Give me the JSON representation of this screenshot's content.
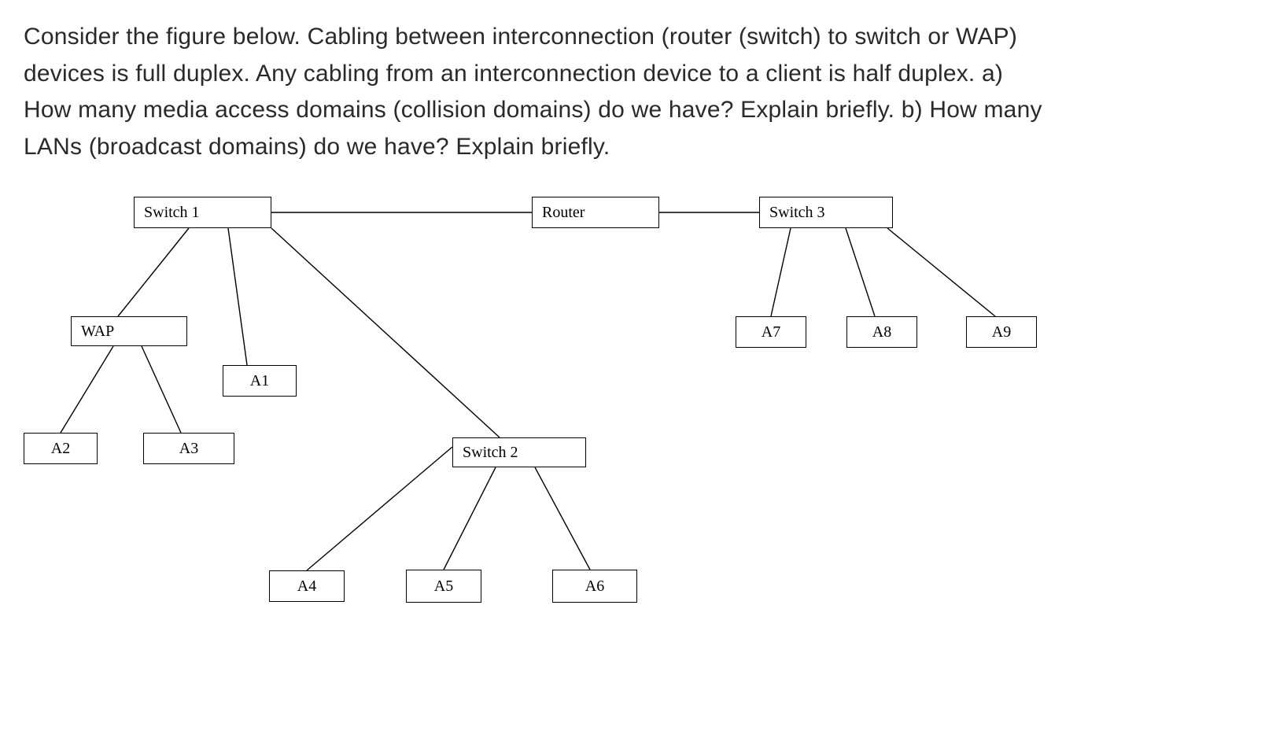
{
  "question": "Consider the figure below. Cabling between interconnection (router (switch) to switch or WAP) devices is full duplex. Any cabling from an interconnection device to a client is half duplex. a) How many media access domains (collision domains) do we have? Explain briefly. b) How many LANs (broadcast domains) do we have? Explain briefly.",
  "nodes": {
    "switch1": "Switch 1",
    "router": "Router",
    "switch3": "Switch 3",
    "wap": "WAP",
    "a1": "A1",
    "a2": "A2",
    "a3": "A3",
    "switch2": "Switch 2",
    "a4": "A4",
    "a5": "A5",
    "a6": "A6",
    "a7": "A7",
    "a8": "A8",
    "a9": "A9"
  },
  "edges": [
    [
      "switch1",
      "router",
      "full-duplex"
    ],
    [
      "router",
      "switch3",
      "full-duplex"
    ],
    [
      "switch1",
      "wap",
      "full-duplex"
    ],
    [
      "switch1",
      "switch2",
      "full-duplex"
    ],
    [
      "switch1",
      "a1",
      "half-duplex"
    ],
    [
      "wap",
      "a2",
      "half-duplex"
    ],
    [
      "wap",
      "a3",
      "half-duplex"
    ],
    [
      "switch2",
      "a4",
      "half-duplex"
    ],
    [
      "switch2",
      "a5",
      "half-duplex"
    ],
    [
      "switch2",
      "a6",
      "half-duplex"
    ],
    [
      "switch3",
      "a7",
      "half-duplex"
    ],
    [
      "switch3",
      "a8",
      "half-duplex"
    ],
    [
      "switch3",
      "a9",
      "half-duplex"
    ]
  ]
}
